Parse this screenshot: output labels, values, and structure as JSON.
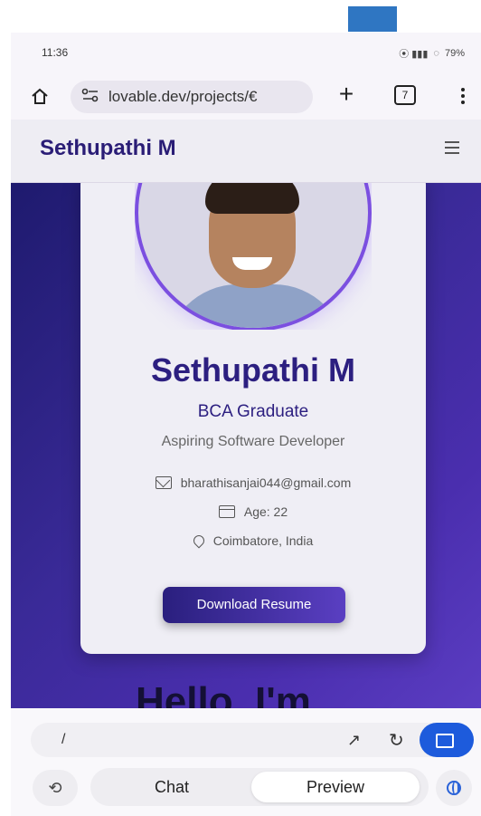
{
  "status_bar": {
    "time": "11:36",
    "battery": "79%"
  },
  "browser": {
    "url": "lovable.dev/projects/€",
    "tab_count": "7"
  },
  "site": {
    "title": "Sethupathi M"
  },
  "profile": {
    "name": "Sethupathi M",
    "degree": "BCA Graduate",
    "tagline": "Aspiring Software Developer",
    "email": "bharathisanjai044@gmail.com",
    "age": "Age: 22",
    "location": "Coimbatore, India",
    "download_label": "Download Resume"
  },
  "hero": {
    "hello_text": "Hello, I'm"
  },
  "editor_bar": {
    "path": "/"
  },
  "bottom_tabs": {
    "chat": "Chat",
    "preview": "Preview",
    "active": "preview"
  },
  "colors": {
    "accent": "#2c1f80",
    "hero_gradient_start": "#1e1a6e",
    "hero_gradient_end": "#5b3dc2",
    "device_button": "#1d5bdc"
  },
  "icons": [
    "home-icon",
    "site-settings-icon",
    "plus-icon",
    "tabs-icon",
    "more-vert-icon",
    "hamburger-icon",
    "mail-icon",
    "calendar-icon",
    "location-pin-icon",
    "open-external-icon",
    "refresh-icon",
    "device-preview-icon",
    "history-icon",
    "globe-icon"
  ]
}
